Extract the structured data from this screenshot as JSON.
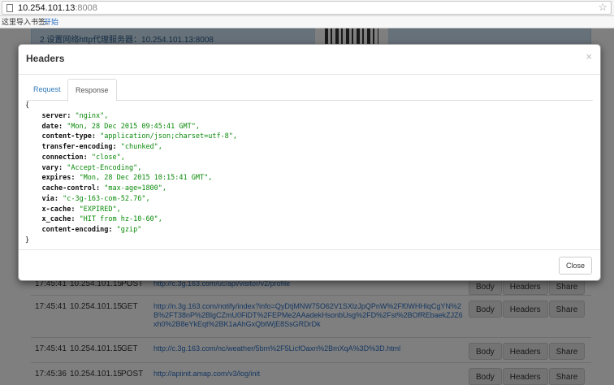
{
  "browser": {
    "url_host": "10.254.101.13",
    "url_port": ":8008",
    "bookmarks_text": "这里导入书签。",
    "bookmarks_link": "开始"
  },
  "page": {
    "banner_line1": "2.设置网络http代理服务器：10.254.101.13:8008",
    "rows": [
      {
        "time": "17:45:41",
        "ip": "10.254.101.15",
        "method": "POST",
        "url": "http://c.3g.163.com/uc/api/visitor/v2/profile",
        "body": "Body",
        "headers": "Headers",
        "share": "Share"
      },
      {
        "time": "17:45:41",
        "ip": "10.254.101.15",
        "method": "GET",
        "url": "http://n.3g.163.com/notify/index?info=QyDtjMNW75O62V1SXlzJpQPnW%2Ff0WHHlqCgYN%2B%2FT38nP%2BlgCZmU0FiDT%2FEPMe2AAadekHsonbUsg%2FD%2Fst%2BOfREbaekZJZ6xh0%2B8eYkEqt%2BK1aAhGxQbtWjE8SsGRDrDk",
        "body": "Body",
        "headers": "Headers",
        "share": "Share"
      },
      {
        "time": "17:45:41",
        "ip": "10.254.101.15",
        "method": "GET",
        "url": "http://c.3g.163.com/nc/weather/5bm%2F5LicfOaxn%2BmXqA%3D%3D.html",
        "body": "Body",
        "headers": "Headers",
        "share": "Share"
      },
      {
        "time": "17:45:36",
        "ip": "10.254.101.15",
        "method": "POST",
        "url": "http://apiinit.amap.com/v3/log/init",
        "body": "Body",
        "headers": "Headers",
        "share": "Share"
      }
    ]
  },
  "modal": {
    "title": "Headers",
    "close_x": "×",
    "tabs": [
      "Request",
      "Response"
    ],
    "active_tab": "Response",
    "open_brace": "{",
    "close_brace": "}",
    "headers": [
      {
        "key": "server",
        "value": "\"nginx\","
      },
      {
        "key": "date",
        "value": "\"Mon, 28 Dec 2015 09:45:41 GMT\","
      },
      {
        "key": "content-type",
        "value": "\"application/json;charset=utf-8\","
      },
      {
        "key": "transfer-encoding",
        "value": "\"chunked\","
      },
      {
        "key": "connection",
        "value": "\"close\","
      },
      {
        "key": "vary",
        "value": "\"Accept-Encoding\","
      },
      {
        "key": "expires",
        "value": "\"Mon, 28 Dec 2015 10:15:41 GMT\","
      },
      {
        "key": "cache-control",
        "value": "\"max-age=1800\","
      },
      {
        "key": "via",
        "value": "\"c-3g-163-com-52.76\","
      },
      {
        "key": "x-cache",
        "value": "\"EXPIRED\","
      },
      {
        "key": "x_cache",
        "value": "\"HIT from hz-10-60\","
      },
      {
        "key": "content-encoding",
        "value": "\"gzip\""
      }
    ],
    "close_button": "Close"
  }
}
